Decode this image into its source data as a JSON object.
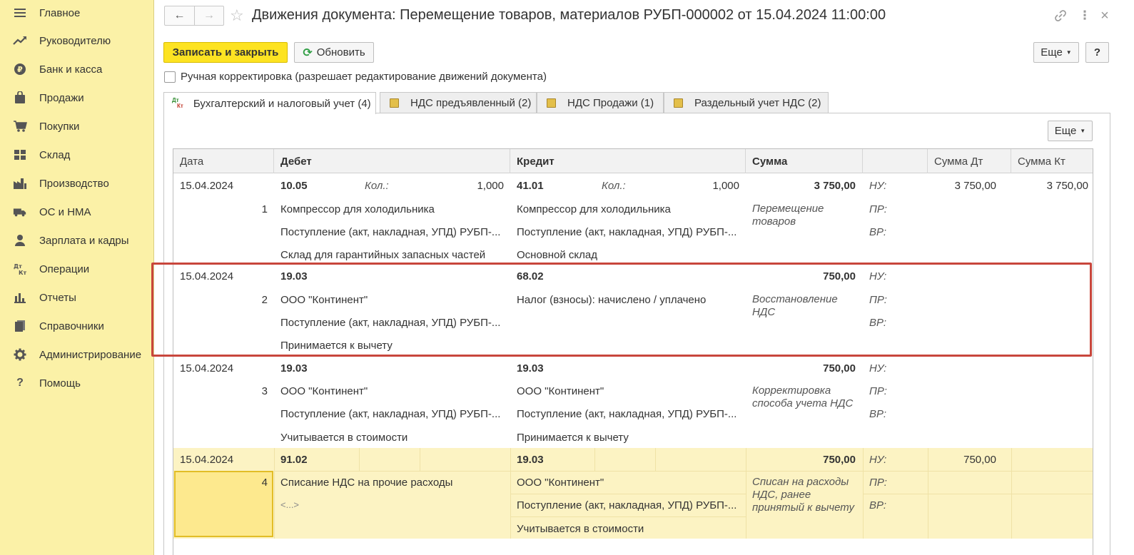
{
  "sidebar": {
    "items": [
      {
        "label": "Главное",
        "icon": "menu-icon"
      },
      {
        "label": "Руководителю",
        "icon": "trend-icon"
      },
      {
        "label": "Банк и касса",
        "icon": "ruble-icon"
      },
      {
        "label": "Продажи",
        "icon": "bag-icon"
      },
      {
        "label": "Покупки",
        "icon": "cart-icon"
      },
      {
        "label": "Склад",
        "icon": "warehouse-icon"
      },
      {
        "label": "Производство",
        "icon": "factory-icon"
      },
      {
        "label": "ОС и НМА",
        "icon": "truck-icon"
      },
      {
        "label": "Зарплата и кадры",
        "icon": "person-icon"
      },
      {
        "label": "Операции",
        "icon": "dt-kt-icon"
      },
      {
        "label": "Отчеты",
        "icon": "bar-chart-icon"
      },
      {
        "label": "Справочники",
        "icon": "books-icon"
      },
      {
        "label": "Администрирование",
        "icon": "gear-icon"
      },
      {
        "label": "Помощь",
        "icon": "question-icon"
      }
    ]
  },
  "header": {
    "title": "Движения документа: Перемещение товаров, материалов РУБП-000002 от 15.04.2024 11:00:00"
  },
  "toolbar": {
    "save_close": "Записать и закрыть",
    "refresh": "Обновить",
    "more": "Еще",
    "help": "?"
  },
  "manual": {
    "label": "Ручная корректировка (разрешает редактирование движений документа)"
  },
  "tabs": [
    {
      "label": "Бухгалтерский и налоговый учет (4)"
    },
    {
      "label": "НДС предъявленный (2)"
    },
    {
      "label": "НДС Продажи (1)"
    },
    {
      "label": "Раздельный учет НДС (2)"
    }
  ],
  "panel": {
    "more": "Еще"
  },
  "table": {
    "columns": [
      "Дата",
      "Дебет",
      "Кредит",
      "Сумма",
      "",
      "Сумма Дт",
      "Сумма Кт"
    ],
    "kol_label": "Кол.:",
    "nu": "НУ:",
    "pr": "ПР:",
    "vr": "ВР:",
    "rows": [
      {
        "date": "15.04.2024",
        "num": "1",
        "debit": "10.05",
        "debit_qty": "1,000",
        "debit_sub": [
          "Компрессор для холодильника",
          "Поступление (акт, накладная, УПД) РУБП-...",
          "Склад для гарантийных запасных частей"
        ],
        "credit": "41.01",
        "credit_qty": "1,000",
        "credit_sub": [
          "Компрессор для холодильника",
          "Поступление (акт, накладная, УПД) РУБП-...",
          "Основной склад"
        ],
        "sum": "3 750,00",
        "content": "Перемещение товаров",
        "sum_dt": "3 750,00",
        "sum_kt": "3 750,00"
      },
      {
        "date": "15.04.2024",
        "num": "2",
        "debit": "19.03",
        "debit_sub": [
          "ООО \"Континент\"",
          "Поступление (акт, накладная, УПД) РУБП-...",
          "Принимается к вычету"
        ],
        "credit": "68.02",
        "credit_sub": [
          "Налог (взносы): начислено / уплачено"
        ],
        "sum": "750,00",
        "content": "Восстановление НДС"
      },
      {
        "date": "15.04.2024",
        "num": "3",
        "debit": "19.03",
        "debit_sub": [
          "ООО \"Континент\"",
          "Поступление (акт, накладная, УПД) РУБП-...",
          "Учитывается в стоимости"
        ],
        "credit": "19.03",
        "credit_sub": [
          "ООО \"Континент\"",
          "Поступление (акт, накладная, УПД) РУБП-...",
          "Принимается к вычету"
        ],
        "sum": "750,00",
        "content": "Корректировка способа учета НДС"
      },
      {
        "date": "15.04.2024",
        "num": "4",
        "debit": "91.02",
        "debit_sub": [
          "Списание НДС на прочие расходы",
          "<...>"
        ],
        "credit": "19.03",
        "credit_sub": [
          "ООО \"Континент\"",
          "Поступление (акт, накладная, УПД) РУБП-...",
          "Учитывается в стоимости"
        ],
        "sum": "750,00",
        "content": "Списан на расходы НДС, ранее принятый к вычету",
        "sum_dt": "750,00"
      }
    ]
  },
  "colors": {
    "sidebar_bg": "#fbf1a7",
    "primary_button": "#fde322",
    "selected_row": "#fcf3c3",
    "highlight_frame": "#c8463c"
  }
}
